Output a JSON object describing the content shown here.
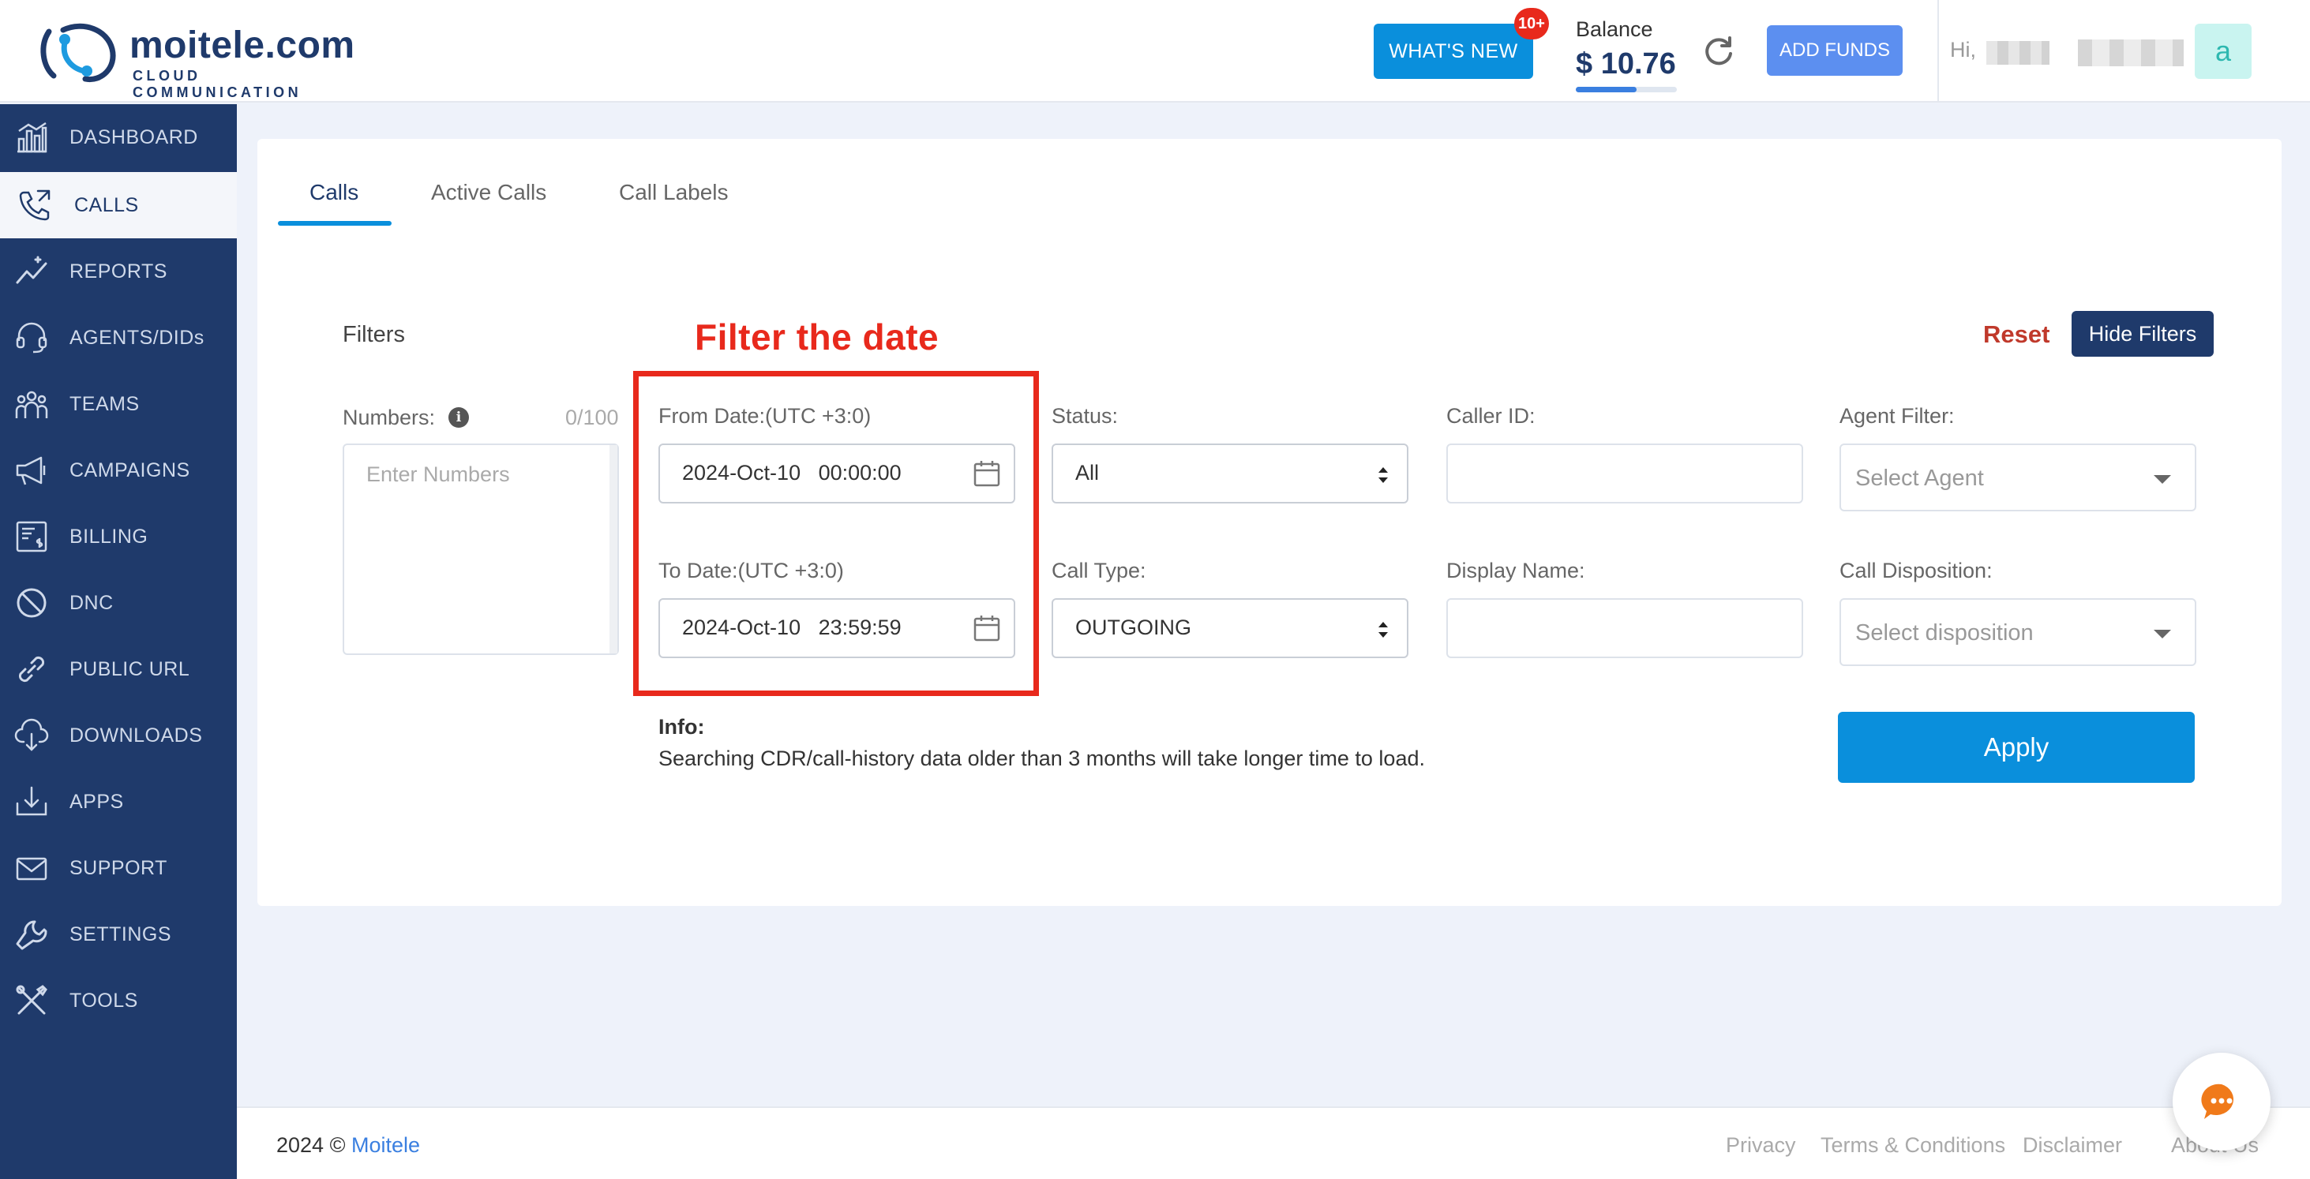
{
  "brand": {
    "name": "moitele",
    "tld": ".com",
    "tagline": "CLOUD COMMUNICATION"
  },
  "header": {
    "whats_new": "WHAT'S NEW",
    "whats_new_badge": "10+",
    "balance_label": "Balance",
    "balance_value": "$ 10.76",
    "balance_progress": 0.6,
    "add_funds": "ADD FUNDS",
    "greeting": "Hi,",
    "avatar_initial": "a"
  },
  "sidebar": {
    "items": [
      {
        "label": "DASHBOARD",
        "icon": "dashboard-icon"
      },
      {
        "label": "CALLS",
        "icon": "calls-icon",
        "active": true
      },
      {
        "label": "REPORTS",
        "icon": "reports-icon"
      },
      {
        "label": "AGENTS/DIDs",
        "icon": "headset-icon"
      },
      {
        "label": "TEAMS",
        "icon": "teams-icon"
      },
      {
        "label": "CAMPAIGNS",
        "icon": "megaphone-icon"
      },
      {
        "label": "BILLING",
        "icon": "billing-icon"
      },
      {
        "label": "DNC",
        "icon": "ban-icon"
      },
      {
        "label": "PUBLIC URL",
        "icon": "link-icon"
      },
      {
        "label": "DOWNLOADS",
        "icon": "cloud-download-icon"
      },
      {
        "label": "APPS",
        "icon": "apps-download-icon"
      },
      {
        "label": "SUPPORT",
        "icon": "envelope-icon"
      },
      {
        "label": "SETTINGS",
        "icon": "wrench-icon"
      },
      {
        "label": "TOOLS",
        "icon": "tools-icon"
      }
    ]
  },
  "tabs": [
    {
      "label": "Calls",
      "active": true
    },
    {
      "label": "Active Calls"
    },
    {
      "label": "Call Labels"
    }
  ],
  "filters": {
    "title": "Filters",
    "annotation": "Filter the date",
    "reset": "Reset",
    "hide_filters": "Hide Filters",
    "numbers_label": "Numbers:",
    "numbers_counter": "0/100",
    "numbers_placeholder": "Enter Numbers",
    "from_date_label": "From Date:(UTC +3:0)",
    "from_date_value": "2024-Oct-10   00:00:00",
    "to_date_label": "To Date:(UTC +3:0)",
    "to_date_value": "2024-Oct-10   23:59:59",
    "status_label": "Status:",
    "status_value": "All",
    "call_type_label": "Call Type:",
    "call_type_value": "OUTGOING",
    "caller_id_label": "Caller ID:",
    "caller_id_value": "",
    "display_name_label": "Display Name:",
    "display_name_value": "",
    "agent_filter_label": "Agent Filter:",
    "agent_placeholder": "Select Agent",
    "call_disposition_label": "Call Disposition:",
    "disposition_placeholder": "Select disposition",
    "info_title": "Info:",
    "info_text": "Searching CDR/call-history data older than 3 months will take longer time to load.",
    "apply": "Apply"
  },
  "footer": {
    "copyright": "2024 ©",
    "company": "Moitele",
    "links": [
      "Privacy",
      "Terms & Conditions",
      "Disclaimer",
      "About Us"
    ]
  },
  "colors": {
    "sidebar": "#1f3a6b",
    "primary": "#0a8fdc",
    "annotation": "#e8291c",
    "reset": "#c0392b"
  }
}
